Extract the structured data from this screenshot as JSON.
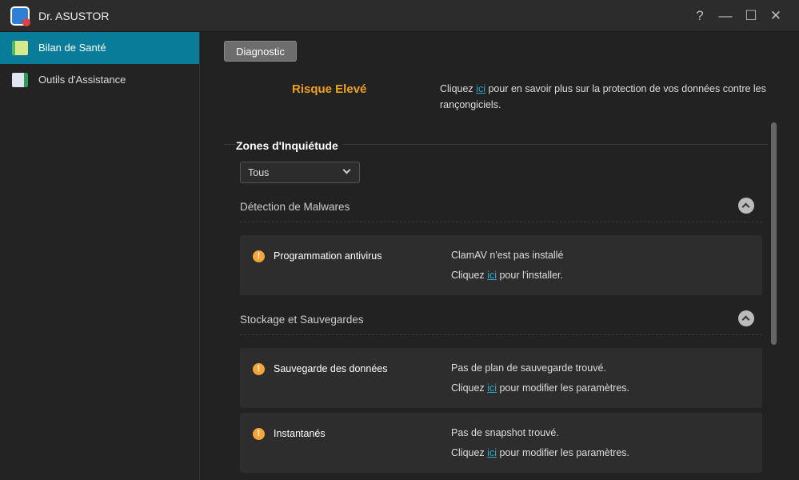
{
  "window": {
    "title": "Dr. ASUSTOR",
    "help": "?",
    "minimize": "—",
    "maximize": "☐",
    "close": "✕"
  },
  "sidebar": {
    "items": [
      {
        "label": "Bilan de Santé"
      },
      {
        "label": "Outils d'Assistance"
      }
    ]
  },
  "main": {
    "diagnostic_label": "Diagnostic",
    "risk": "Risque Elevé",
    "info": {
      "pre": "Cliquez ",
      "link": "ici",
      "post": " pour en savoir plus sur la protection de vos données contre les rançongiciels."
    },
    "zones_title": "Zones d'Inquiétude",
    "filter": {
      "selected": "Tous"
    },
    "sections": [
      {
        "title": "Détection de Malwares",
        "items": [
          {
            "name": "Programmation antivirus",
            "line1": "ClamAV n'est pas installé",
            "pre": "Cliquez ",
            "link": "ici",
            "post": " pour l'installer."
          }
        ]
      },
      {
        "title": "Stockage et Sauvegardes",
        "items": [
          {
            "name": "Sauvegarde des données",
            "line1": "Pas de plan de sauvegarde trouvé.",
            "pre": "Cliquez ",
            "link": "ici",
            "post": " pour modifier les paramètres."
          },
          {
            "name": "Instantanés",
            "line1": "Pas de snapshot trouvé.",
            "pre": "Cliquez ",
            "link": "ici",
            "post": " pour modifier les paramètres."
          }
        ]
      }
    ]
  },
  "colors": {
    "accent": "#087c98",
    "risk": "#f0a023",
    "link": "#2fa7c8"
  }
}
